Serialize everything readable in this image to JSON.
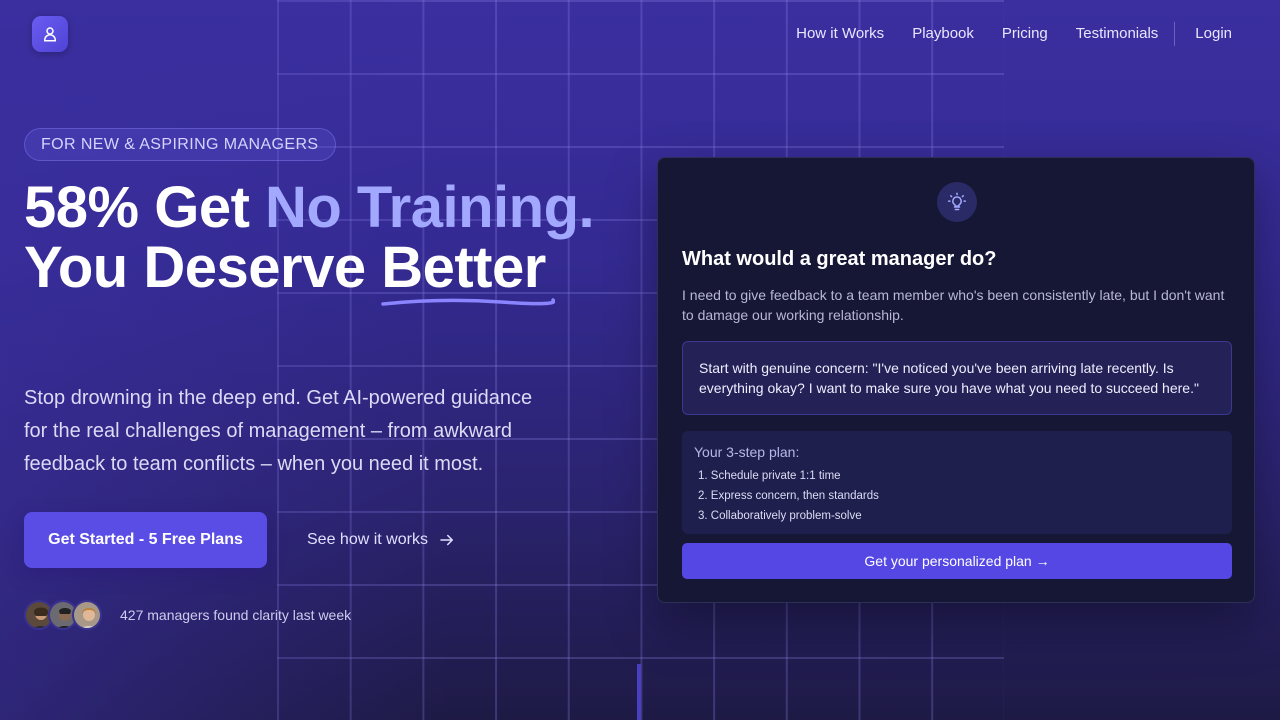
{
  "nav": {
    "items": [
      {
        "label": "How it Works"
      },
      {
        "label": "Playbook"
      },
      {
        "label": "Pricing"
      },
      {
        "label": "Testimonials"
      }
    ],
    "login_label": "Login",
    "logo_icon": "user-icon"
  },
  "hero": {
    "badge": "FOR NEW & ASPIRING MANAGERS",
    "headline": {
      "part1": "58% Get ",
      "accent": "No Training.",
      "part2": "You Deserve ",
      "underlined": "Better"
    },
    "subtitle": "Stop drowning in the deep end. Get AI-powered guidance for the real challenges of management – from awkward feedback to team conflicts – when you need it most.",
    "primary_cta": "Get Started - 5 Free Plans",
    "secondary_cta": "See how it works",
    "social_proof": "427 managers found clarity last week"
  },
  "card": {
    "icon": "lightbulb-icon",
    "title": "What would a great manager do?",
    "question": "I need to give feedback to a team member who's been consistently late, but I don't want to damage our working relationship.",
    "answer": "Start with genuine concern: \"I've noticed you've been arriving late recently. Is everything okay? I want to make sure you have what you need to succeed here.\"",
    "plan_title": "Your 3-step plan:",
    "plan_steps": [
      "1. Schedule private 1:1 time",
      "2. Express concern, then standards",
      "3. Collaboratively problem-solve"
    ],
    "cta": "Get your personalized plan →"
  },
  "colors": {
    "accent": "#a3a8ff",
    "primary_button": "#5a4de6",
    "card_bg": "#161735"
  }
}
